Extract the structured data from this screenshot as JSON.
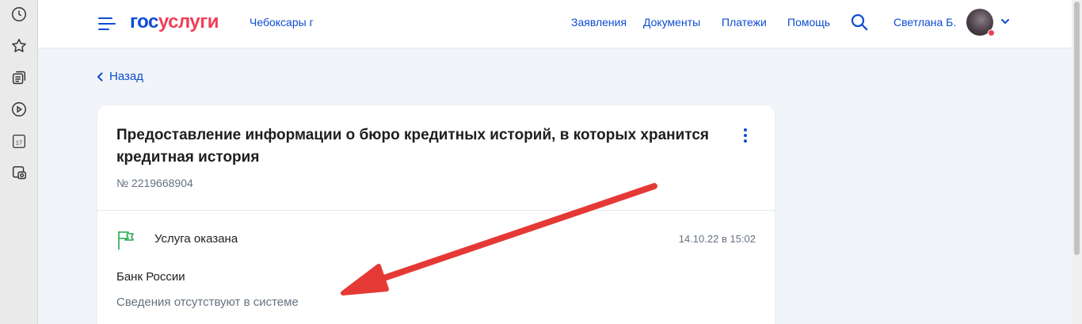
{
  "side_rail": {
    "items": [
      {
        "icon": "clock-icon"
      },
      {
        "icon": "star-icon"
      },
      {
        "icon": "collections-icon"
      },
      {
        "icon": "play-icon"
      },
      {
        "icon": "calendar-icon",
        "label": "17"
      },
      {
        "icon": "screenshot-icon"
      }
    ]
  },
  "header": {
    "logo_part1": "гос",
    "logo_part2": "услуги",
    "city": "Чебоксары г",
    "nav": [
      "Заявления",
      "Документы",
      "Платежи",
      "Помощь"
    ],
    "user_name": "Светлана Б.",
    "colors": {
      "brand_blue": "#0d4cd3",
      "brand_red": "#ee3f58"
    }
  },
  "back_label": "Назад",
  "order": {
    "title": "Предоставление информации о бюро кредитных историй, в которых хранится кредитная история",
    "number": "№ 2219668904",
    "status": "Услуга оказана",
    "status_time": "14.10.22 в 15:02",
    "organization": "Банк России",
    "result_text": "Сведения отсутствуют в системе",
    "status_color": "#23a84b"
  },
  "annotation": {
    "type": "red-arrow",
    "color": "#e53935"
  }
}
